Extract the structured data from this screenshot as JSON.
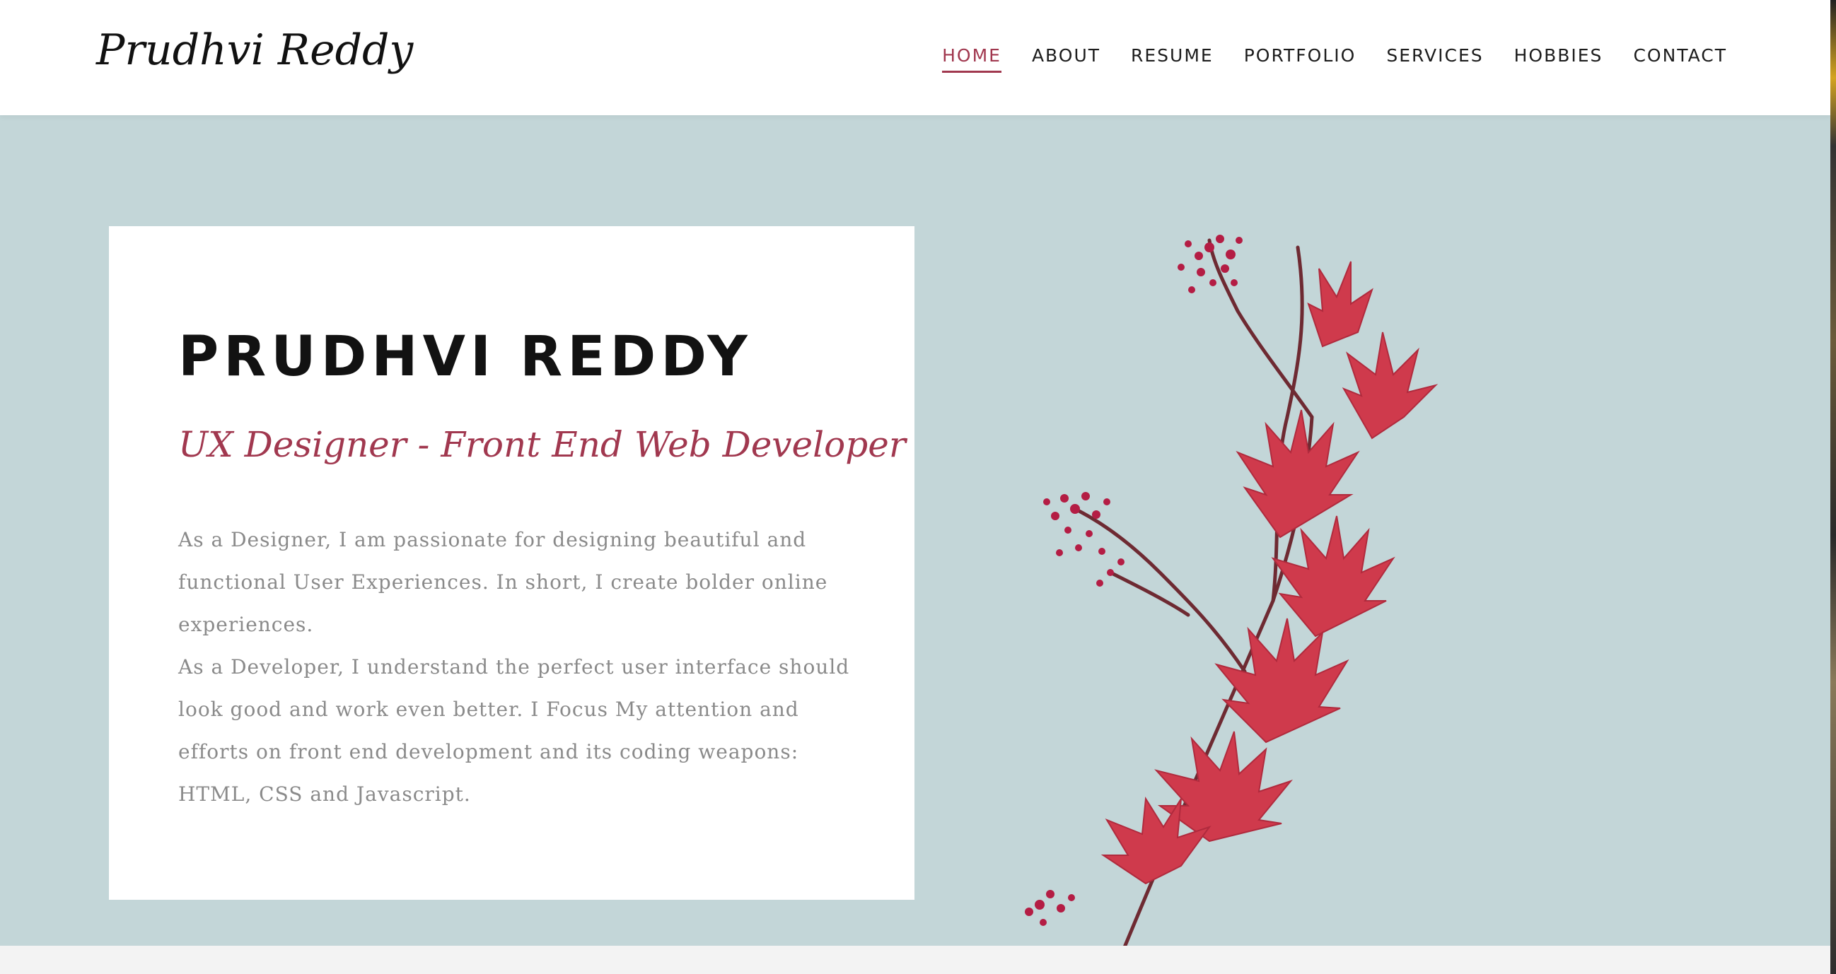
{
  "header": {
    "brand": "Prudhvi Reddy",
    "nav": [
      {
        "label": "HOME",
        "active": true
      },
      {
        "label": "ABOUT",
        "active": false
      },
      {
        "label": "RESUME",
        "active": false
      },
      {
        "label": "PORTFOLIO",
        "active": false
      },
      {
        "label": "SERVICES",
        "active": false
      },
      {
        "label": "HOBBIES",
        "active": false
      },
      {
        "label": "CONTACT",
        "active": false
      }
    ]
  },
  "hero": {
    "title": "PRUDHVI REDDY",
    "subtitle": "UX Designer - Front End Web Developer",
    "paragraphs": [
      "As a Designer, I am passionate for designing beautiful and functional User Experiences. In short, I create bolder online experiences.",
      "As a Developer, I understand the perfect user interface should look good and work even better. I Focus My attention and efforts on front end development and its coding weapons: HTML, CSS and Javascript."
    ],
    "image": "red-maple-leaves-and-flowers-branch"
  },
  "colors": {
    "background": "#c3d6d8",
    "accent": "#a1384f",
    "header": "#ffffff",
    "body_text": "#8a8a8a",
    "title_text": "#121212"
  }
}
